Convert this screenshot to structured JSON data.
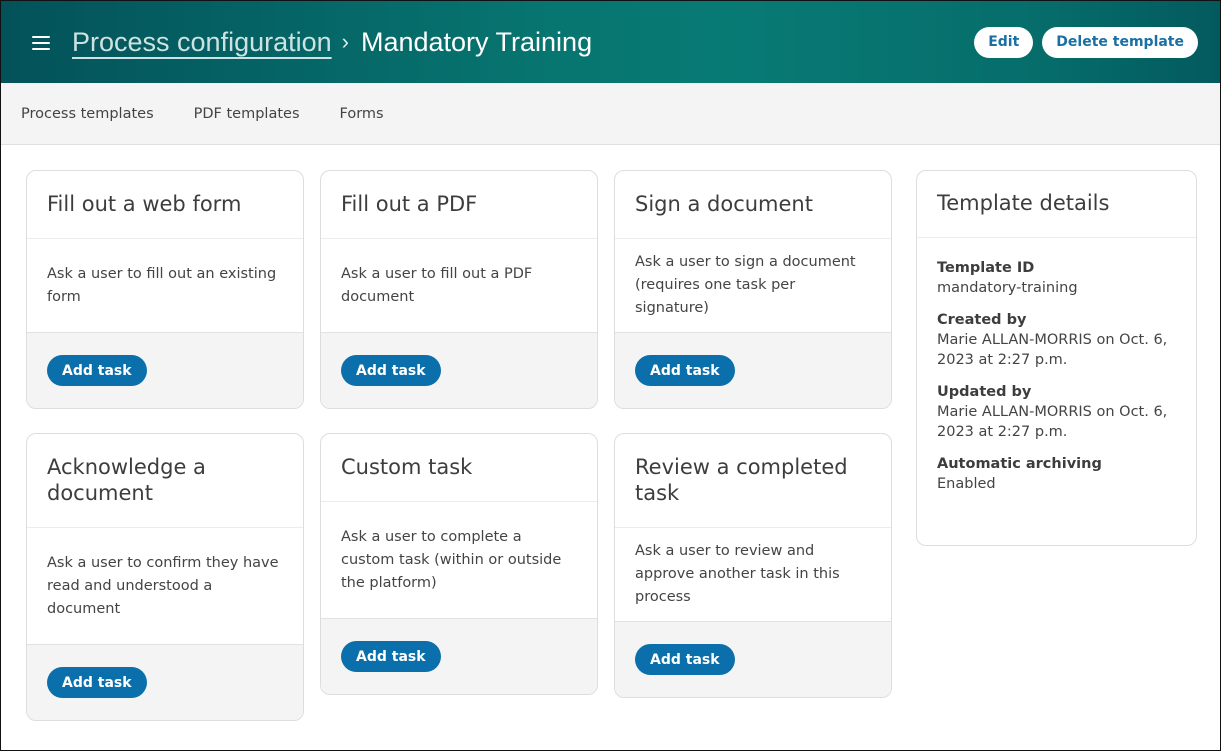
{
  "header": {
    "menu_icon": "hamburger-menu-icon",
    "breadcrumb": {
      "parent": "Process configuration",
      "separator": "›",
      "current": "Mandatory Training"
    },
    "actions": {
      "edit_label": "Edit",
      "delete_label": "Delete template"
    }
  },
  "subnav": {
    "items": [
      {
        "label": "Process templates"
      },
      {
        "label": "PDF templates"
      },
      {
        "label": "Forms"
      }
    ]
  },
  "task_cards": [
    {
      "title": "Fill out a web form",
      "description": "Ask a user to fill out an existing form",
      "button_label": "Add task"
    },
    {
      "title": "Fill out a PDF",
      "description": "Ask a user to fill out a PDF document",
      "button_label": "Add task"
    },
    {
      "title": "Sign a document",
      "description": "Ask a user to sign a document (requires one task per signature)",
      "button_label": "Add task"
    },
    {
      "title": "Acknowledge a document",
      "description": "Ask a user to confirm they have read and understood a document",
      "button_label": "Add task"
    },
    {
      "title": "Custom task",
      "description": "Ask a user to complete a custom task (within or outside the platform)",
      "button_label": "Add task"
    },
    {
      "title": "Review a completed task",
      "description": "Ask a user to review and approve another task in this process",
      "button_label": "Add task"
    }
  ],
  "template_details": {
    "title": "Template details",
    "items": [
      {
        "label": "Template ID",
        "value": "mandatory-training"
      },
      {
        "label": "Created by",
        "value": "Marie ALLAN-MORRIS on Oct. 6, 2023 at 2:27 p.m."
      },
      {
        "label": "Updated by",
        "value": "Marie ALLAN-MORRIS on Oct. 6, 2023 at 2:27 p.m."
      },
      {
        "label": "Automatic archiving",
        "value": "Enabled"
      }
    ]
  },
  "colors": {
    "header_teal": "#077570",
    "primary_button": "#0b6fab",
    "link_blue": "#1a6fa3"
  }
}
